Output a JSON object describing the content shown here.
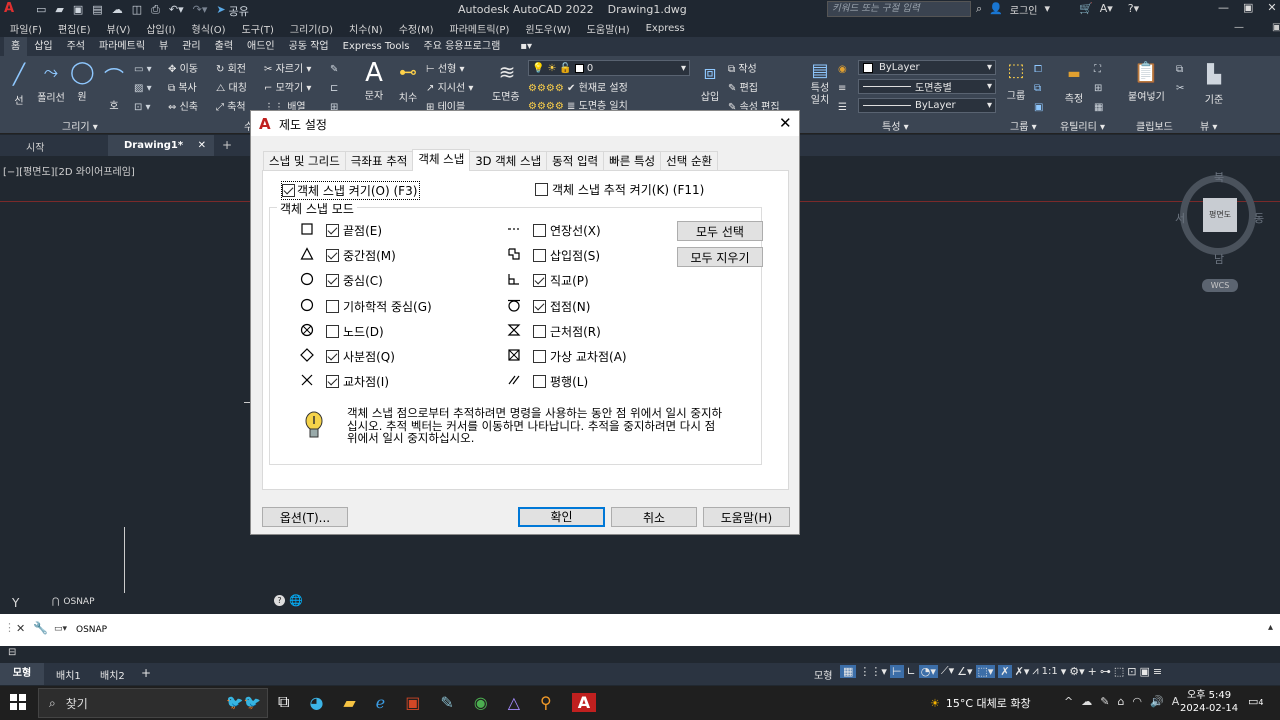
{
  "app": {
    "title": "Autodesk AutoCAD 2022",
    "filename": "Drawing1.dwg",
    "share_label": "공유",
    "search_placeholder": "키워드 또는 구절 입력",
    "login_label": "로그인"
  },
  "menubar": [
    "파일(F)",
    "편집(E)",
    "뷰(V)",
    "삽입(I)",
    "형식(O)",
    "도구(T)",
    "그리기(D)",
    "치수(N)",
    "수정(M)",
    "파라메트릭(P)",
    "윈도우(W)",
    "도움말(H)",
    "Express"
  ],
  "ribbon_tabs": [
    "홈",
    "삽입",
    "주석",
    "파라메트릭",
    "뷰",
    "관리",
    "출력",
    "애드인",
    "공동 작업",
    "Express Tools",
    "주요 응용프로그램"
  ],
  "ribbon": {
    "draw": {
      "line": "선",
      "polyline": "폴리선",
      "circle": "원",
      "arc": "호",
      "panel": "그리기"
    },
    "modify": {
      "move": "이동",
      "rotate": "회전",
      "trim": "자르기",
      "copy": "복사",
      "mirror": "대칭",
      "fillet": "모깍기",
      "stretch": "신축",
      "scale": "축척",
      "array": "배열",
      "panel": "수정"
    },
    "annotation": {
      "text": "문자",
      "dimension": "치수",
      "linear": "선형",
      "leader": "지시선",
      "table": "테이블"
    },
    "layers": {
      "properties": "도면층 특성",
      "layer_value": "0",
      "make_current": "현재로 설정",
      "match": "도면층 일치"
    },
    "block": {
      "insert": "삽입",
      "create": "작성",
      "edit": "편집",
      "attr": "속성 편집"
    },
    "properties": {
      "match": "특성 일치",
      "bylayer1": "ByLayer",
      "layer_line": "도면층별",
      "bylayer2": "ByLayer",
      "panel": "특성"
    },
    "groups": {
      "group": "그룹",
      "panel": "그룹"
    },
    "utilities": {
      "measure": "측정",
      "panel": "유틸리티"
    },
    "clipboard": {
      "paste": "붙여넣기",
      "panel": "클립보드"
    },
    "view": {
      "base": "기준",
      "panel": "뷰"
    }
  },
  "doc_tabs": {
    "start": "시작",
    "drawing": "Drawing1*"
  },
  "viewport_label": "[−][평면도][2D 와이어프레임]",
  "viewcube": {
    "north": "북",
    "south": "남",
    "east": "동",
    "west": "서",
    "face": "평면도",
    "wcs": "WCS"
  },
  "dialog": {
    "title": "제도 설정",
    "tabs": [
      "스냅 및 그리드",
      "극좌표 추적",
      "객체 스냅",
      "3D 객체 스냅",
      "동적 입력",
      "빠른 특성",
      "선택 순환"
    ],
    "active_tab": 2,
    "osnap_on": {
      "label": "객체 스냅 켜기(O) (F3)",
      "checked": true
    },
    "osnap_track": {
      "label": "객체 스냅 추적 켜기(K) (F11)",
      "checked": false
    },
    "group_label": "객체 스냅 모드",
    "left_modes": [
      {
        "label": "끝점(E)",
        "checked": true,
        "symbol": "square"
      },
      {
        "label": "중간점(M)",
        "checked": true,
        "symbol": "triangle"
      },
      {
        "label": "중심(C)",
        "checked": true,
        "symbol": "circle"
      },
      {
        "label": "기하학적 중심(G)",
        "checked": false,
        "symbol": "circle"
      },
      {
        "label": "노드(D)",
        "checked": false,
        "symbol": "node"
      },
      {
        "label": "사분점(Q)",
        "checked": true,
        "symbol": "diamond"
      },
      {
        "label": "교차점(I)",
        "checked": true,
        "symbol": "x"
      }
    ],
    "right_modes": [
      {
        "label": "연장선(X)",
        "checked": false,
        "symbol": "extension"
      },
      {
        "label": "삽입점(S)",
        "checked": false,
        "symbol": "insert"
      },
      {
        "label": "직교(P)",
        "checked": true,
        "symbol": "perpendicular"
      },
      {
        "label": "접점(N)",
        "checked": true,
        "symbol": "tangent"
      },
      {
        "label": "근처점(R)",
        "checked": false,
        "symbol": "nearest"
      },
      {
        "label": "가상 교차점(A)",
        "checked": false,
        "symbol": "apparent"
      },
      {
        "label": "평행(L)",
        "checked": false,
        "symbol": "parallel"
      }
    ],
    "select_all": "모두 선택",
    "clear_all": "모두 지우기",
    "hint": "객체 스냅 점으로부터 추적하려면 명령을 사용하는 동안 점 위에서 일시 중지하십시오. 추적 벡터는 커서를 이동하면 나타납니다. 추적을 중지하려면 다시 점 위에서 일시 중지하십시오.",
    "options": "옵션(T)...",
    "ok": "확인",
    "cancel": "취소",
    "help": "도움말(H)"
  },
  "command": {
    "history": "OSNAP",
    "current": "OSNAP"
  },
  "layout_tabs": [
    "모형",
    "배치1",
    "배치2"
  ],
  "statusbar": {
    "model": "모형",
    "scale": "1:1"
  },
  "taskbar": {
    "search": "찾기",
    "weather": "15°C 대체로 화창",
    "time": "오후 5:49",
    "date": "2024-02-14",
    "notif": "4"
  },
  "colors": {
    "accent": "#0078d7",
    "autocad_red": "#c0201f",
    "ribbon_bg": "#3b4553",
    "canvas": "#212830"
  }
}
